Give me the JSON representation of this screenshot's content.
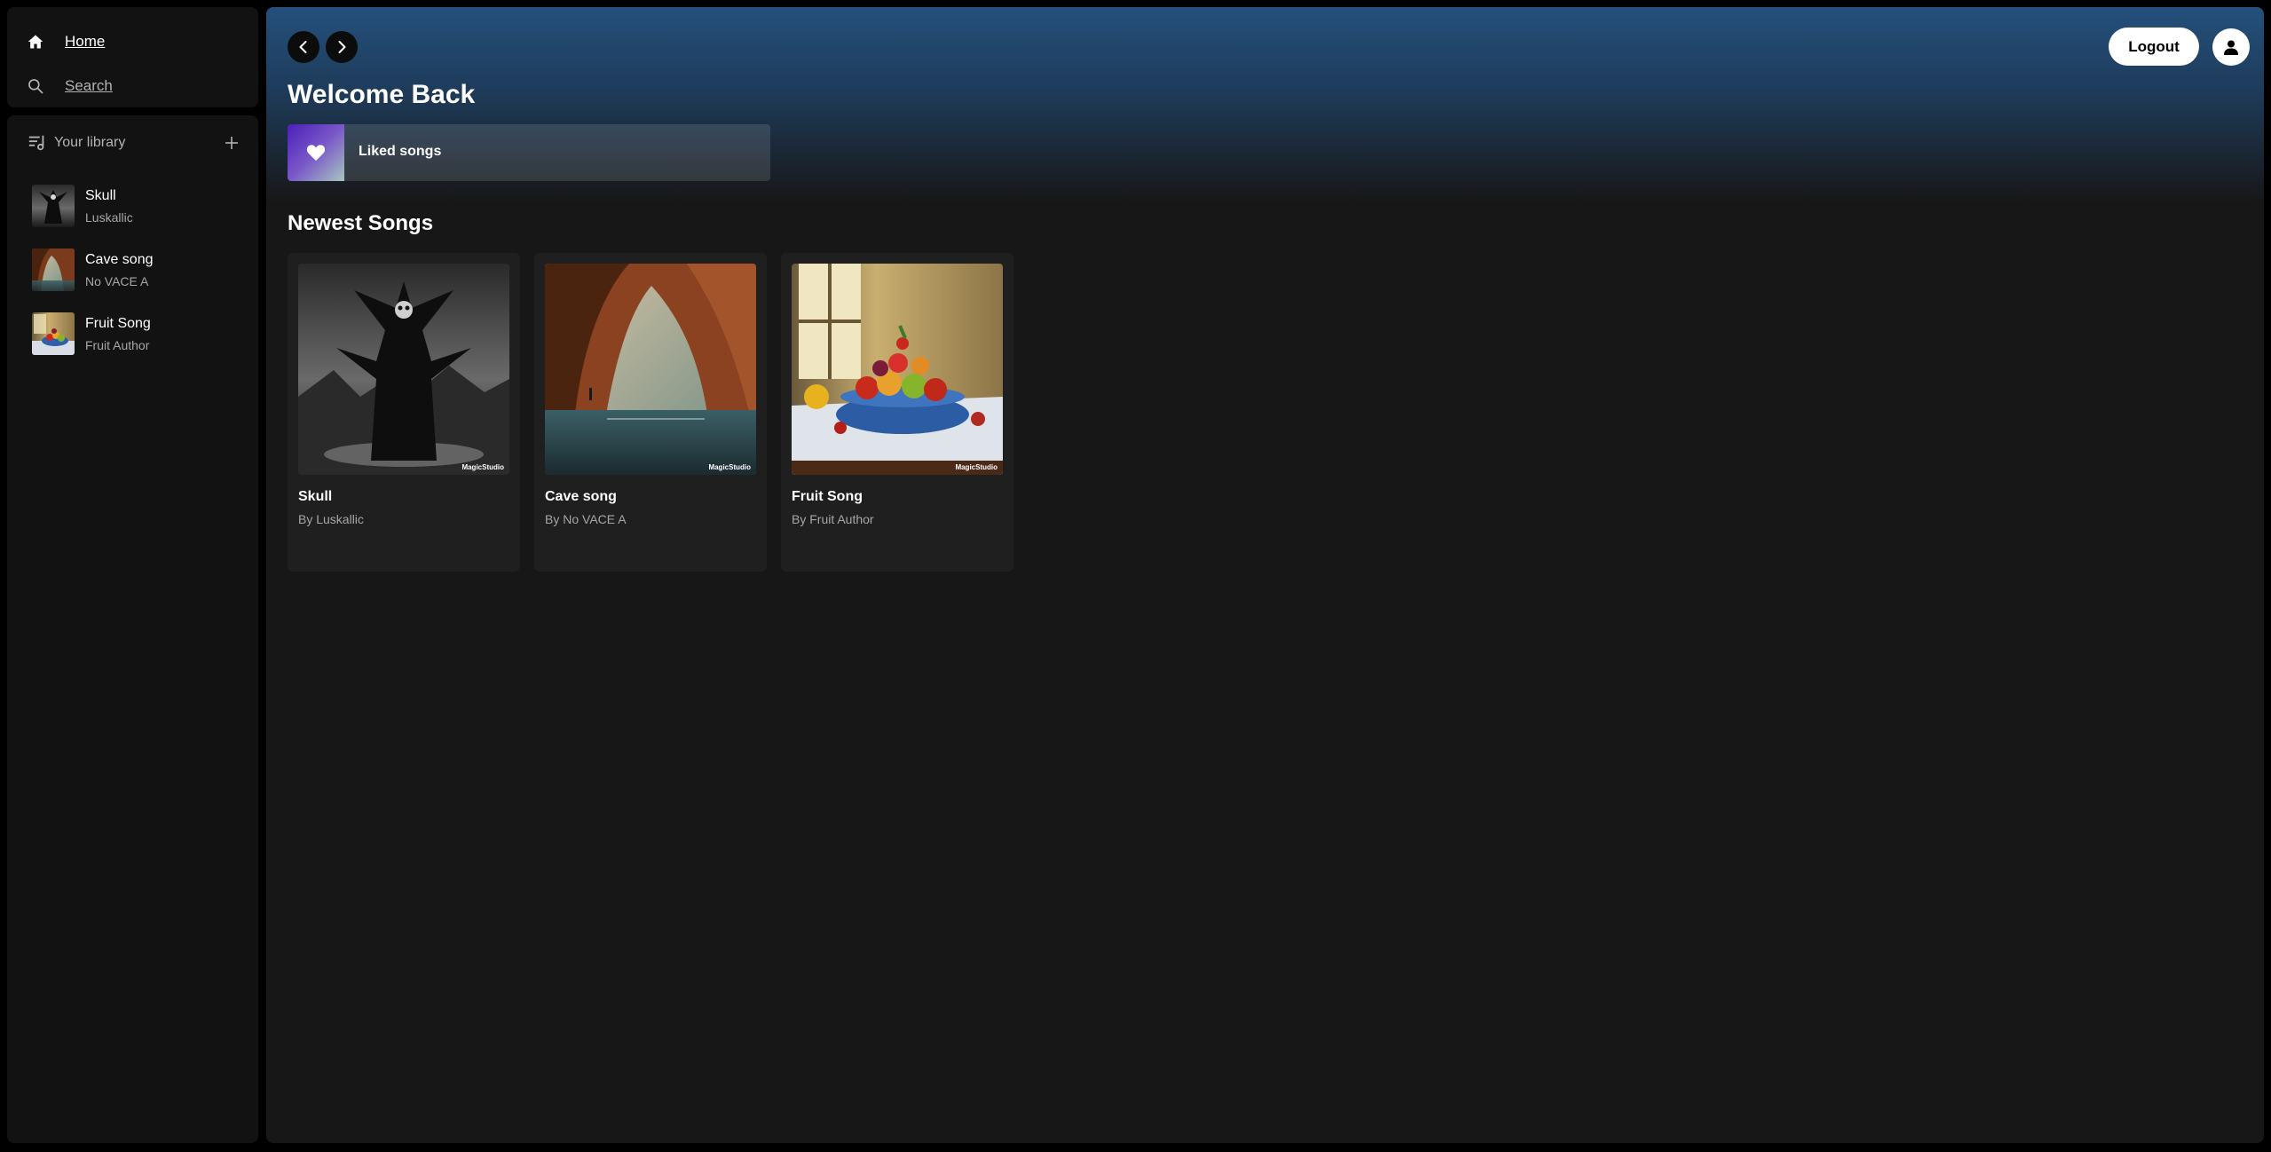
{
  "sidebar": {
    "nav": {
      "home_label": "Home",
      "search_label": "Search"
    },
    "library": {
      "title": "Your library",
      "items": [
        {
          "name": "Skull",
          "artist": "Luskallic"
        },
        {
          "name": "Cave song",
          "artist": "No VACE A"
        },
        {
          "name": "Fruit Song",
          "artist": "Fruit Author"
        }
      ]
    }
  },
  "header": {
    "logout_label": "Logout",
    "welcome": "Welcome Back"
  },
  "liked": {
    "label": "Liked songs"
  },
  "newest": {
    "title": "Newest Songs",
    "cards": [
      {
        "title": "Skull",
        "byline": "By Luskallic",
        "watermark": "MagicStudio"
      },
      {
        "title": "Cave song",
        "byline": "By No VACE A",
        "watermark": "MagicStudio"
      },
      {
        "title": "Fruit Song",
        "byline": "By Fruit Author",
        "watermark": "MagicStudio"
      }
    ]
  },
  "icons": {
    "home": "home-icon",
    "search": "search-icon",
    "library": "library-icon",
    "add": "plus-icon",
    "back": "chevron-left-icon",
    "forward": "chevron-right-icon",
    "user": "user-icon",
    "heart": "heart-icon"
  },
  "colors": {
    "background": "#000000",
    "panel": "#121212",
    "main": "#171717",
    "hero_gradient_top": "#24507c",
    "card": "#1f1f1f",
    "muted_text": "#a7a7a7"
  }
}
